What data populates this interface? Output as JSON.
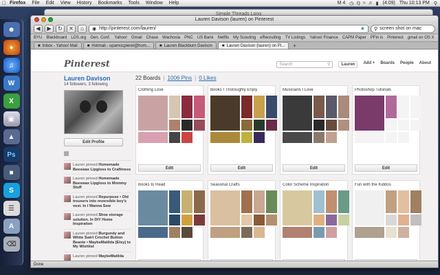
{
  "menubar": {
    "app": "Firefox",
    "items": [
      "File",
      "Edit",
      "View",
      "History",
      "Bookmarks",
      "Tools",
      "Window",
      "Help"
    ],
    "clock": "Thu 10:13 PM",
    "battery": "(4:09)",
    "tray_label": "M 4"
  },
  "bg_window": {
    "title": "Simple Threads Long"
  },
  "window": {
    "title": "Lauren Davison (lauren) on Pinterest"
  },
  "nav": {
    "url": "http://pinterest.com/lauren/",
    "search_value": "screen shot on mac"
  },
  "bookmarks": [
    "BYU",
    "Blackboard",
    "LDS.org",
    "Gen. Conf.",
    "Yahoo!",
    "Gmail",
    "Chase",
    "Wachovia",
    "PNC",
    "US Bank",
    "Netflix",
    "My Scouting",
    "eRecruiting",
    "TV Listings",
    "Yahoo! Finance",
    "CAPM Paper",
    "PFin is",
    "Pinterest",
    "gmail on OS X"
  ],
  "tabs": [
    {
      "label": "Inbox - Yahoo! Mail",
      "active": false
    },
    {
      "label": "Hotmail - opamocpierel@hom...",
      "active": false
    },
    {
      "label": "Lauren Blackburn Davison",
      "active": false
    },
    {
      "label": "Lauren Davison (lauren) on Pi...",
      "active": true
    }
  ],
  "pinterest": {
    "logo": "Pinterest",
    "search_placeholder": "Search",
    "nav": {
      "user": "Lauren",
      "add": "Add +",
      "boards": "Boards",
      "people": "People",
      "about": "About"
    }
  },
  "profile": {
    "name": "Lauren Davison",
    "stats": "14 followers, 3 following",
    "edit_label": "Edit Profile"
  },
  "activity": [
    {
      "text": "Lauren pinned ",
      "bold": "Homemade Beeswax Lipgloss to Craftiness"
    },
    {
      "text": "Lauren pinned ",
      "bold": "Homemade Beeswax Lipgloss to Mommy Stuff"
    },
    {
      "text": "Lauren pinned ",
      "bold": "Repurpose • Old trousers into reversible boy's vest. In I Wanna Sew"
    },
    {
      "text": "Lauren pinned ",
      "bold": "Shoe storage solution. In DIY Home Inspiration"
    },
    {
      "text": "Lauren pinned ",
      "bold": "Burgundy and White Swirl Crochet Button Beanie • MaybeMatilda (Etsy) to My Wishlist"
    },
    {
      "text": "Lauren pinned ",
      "bold": "MaybeMatilda"
    }
  ],
  "stats_bar": {
    "boards": "22 Boards",
    "pins": "1006 Pins",
    "likes": "0 Likes"
  },
  "boards": [
    {
      "title": "Clothing Love",
      "edit": "Edit",
      "colors": [
        "#c9a3a3",
        "#d8c6b0",
        "#8b2b3f",
        "#c65a7a",
        "#b0806e",
        "#2a2a2a",
        "#9a4a5a",
        "#d8a0b0",
        "#444",
        "#c44"
      ]
    },
    {
      "title": "Books I Thoroughly Enjoy",
      "edit": "Edit",
      "colors": [
        "#4a3a2a",
        "#7a2a2a",
        "#c8a050",
        "#3a4a6a",
        "#8a6a3a",
        "#2a3a2a",
        "#6a2a4a",
        "#aa8a3a",
        "#c0b040",
        "#3a2a5a"
      ]
    },
    {
      "title": "Musicians I Love",
      "edit": "Edit",
      "colors": [
        "#3a3a3a",
        "#7a5a4a",
        "#5a5a6a",
        "#aa8a7a",
        "#2a2a2a",
        "#6a4a3a",
        "#b09080",
        "#4a4a4a",
        "#8a7a6a",
        "#c0a090"
      ]
    },
    {
      "title": "Photoshop Tutorials",
      "edit": "Edit",
      "colors": [
        "#7a3a6a",
        "#b06a9a",
        "#f4f4f4",
        "#f4f4f4",
        "#f4f4f4",
        "#f4f4f4",
        "#f4f4f4",
        "#f4f4f4",
        "#f4f4f4",
        "#f4f4f4"
      ]
    },
    {
      "title": "Books to Read",
      "edit": "Edit",
      "colors": [
        "#6a8aa0",
        "#3a5a7a",
        "#c8b070",
        "#8a6a4a",
        "#2a4a6a",
        "#d0a040",
        "#7a3a3a",
        "#4a6a8a",
        "#a08060",
        "#5a4a3a"
      ]
    },
    {
      "title": "Seasonal Crafts",
      "edit": "Edit",
      "colors": [
        "#d8c0a0",
        "#a07050",
        "#c8a890",
        "#6a8a5a",
        "#e0c8a8",
        "#8a5a3a",
        "#b09070",
        "#c0a080",
        "#7a6a5a",
        "#d8b890"
      ]
    },
    {
      "title": "Color Scheme Inspiration",
      "edit": "Edit",
      "colors": [
        "#d8c8a0",
        "#a0c0d0",
        "#c09070",
        "#6a9a8a",
        "#e0b080",
        "#8a6a9a",
        "#c8d0a0",
        "#b08070",
        "#7a9ab0",
        "#d0a0a0"
      ]
    },
    {
      "title": "Fun with the Kiddos",
      "edit": "Edit",
      "colors": [
        "#f0f0f0",
        "#c0a080",
        "#e0c0a0",
        "#a08060",
        "#d8d8d8",
        "#e0b090",
        "#c0c0c0",
        "#b0a090",
        "#e8e0d0",
        "#d0b0a0"
      ]
    }
  ],
  "status": "Done",
  "accent": "#2b6bb8"
}
